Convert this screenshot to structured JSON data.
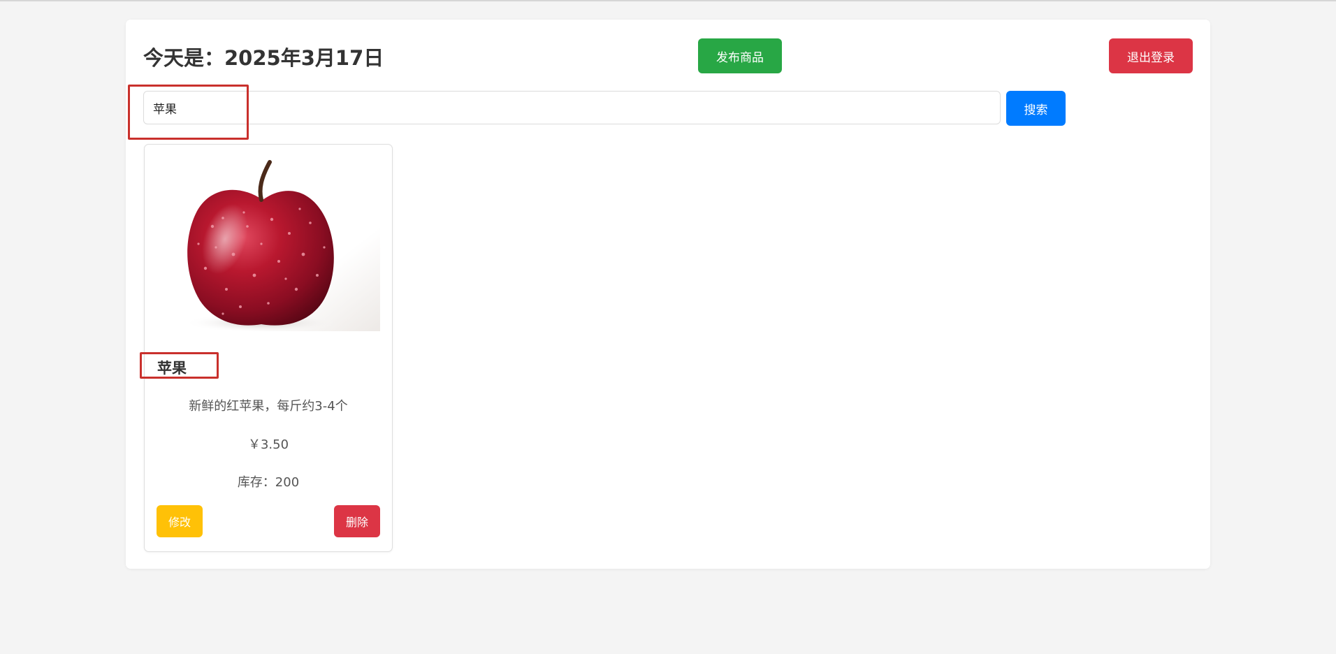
{
  "header": {
    "date_title": "今天是：2025年3月17日",
    "publish_label": "发布商品",
    "logout_label": "退出登录"
  },
  "search": {
    "value": "苹果",
    "button_label": "搜索"
  },
  "products": [
    {
      "name": "苹果",
      "description": "新鲜的红苹果，每斤约3-4个",
      "price": "￥3.50",
      "stock": "库存：200",
      "edit_label": "修改",
      "delete_label": "删除"
    }
  ],
  "colors": {
    "publish": "#28a745",
    "logout": "#dc3545",
    "search": "#007bff",
    "edit": "#ffc107",
    "delete": "#dc3545",
    "highlight": "#c9302c"
  }
}
